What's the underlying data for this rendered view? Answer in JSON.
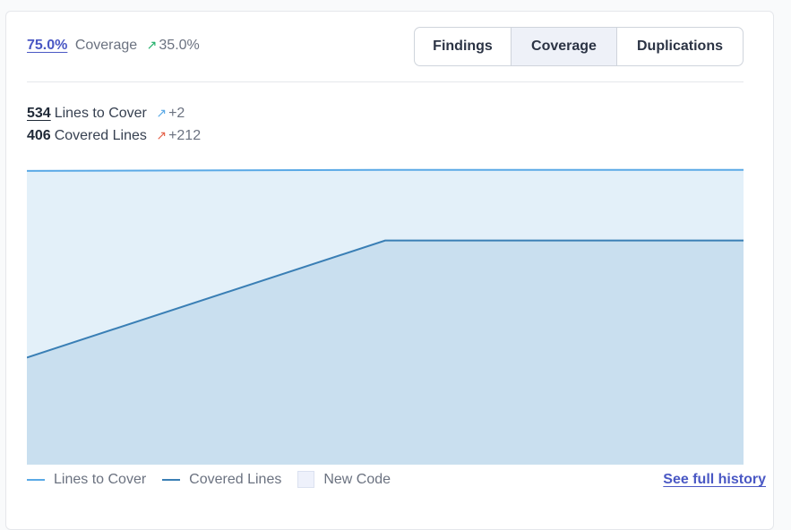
{
  "summary": {
    "coverage_pct": "75.0%",
    "coverage_label": "Coverage",
    "coverage_delta": "35.0%",
    "delta_arrow": "↗"
  },
  "tabs": [
    {
      "label": "Findings",
      "active": false
    },
    {
      "label": "Coverage",
      "active": true
    },
    {
      "label": "Duplications",
      "active": false
    }
  ],
  "stats": {
    "lines_to_cover": {
      "value": "534",
      "label": "Lines to Cover",
      "arrow": "↗",
      "delta": "+2"
    },
    "covered_lines": {
      "value": "406",
      "label": "Covered Lines",
      "arrow": "↗",
      "delta": "+212"
    }
  },
  "colors": {
    "lines_to_cover": "#5aa9e6",
    "covered_lines": "#3a7fb5",
    "lines_to_cover_fill": "#e3f0f9",
    "covered_lines_fill": "#c9dfef",
    "link": "#4a58c4"
  },
  "chart_data": {
    "type": "area",
    "x": [
      0,
      1,
      2
    ],
    "series": [
      {
        "name": "Lines to Cover",
        "values": [
          532,
          534,
          534
        ]
      },
      {
        "name": "Covered Lines",
        "values": [
          194,
          406,
          406
        ]
      }
    ],
    "ylim": [
      0,
      540
    ]
  },
  "legend": {
    "lines_to_cover": "Lines to Cover",
    "covered_lines": "Covered Lines",
    "new_code": "New Code"
  },
  "link": {
    "label": "See full history"
  }
}
